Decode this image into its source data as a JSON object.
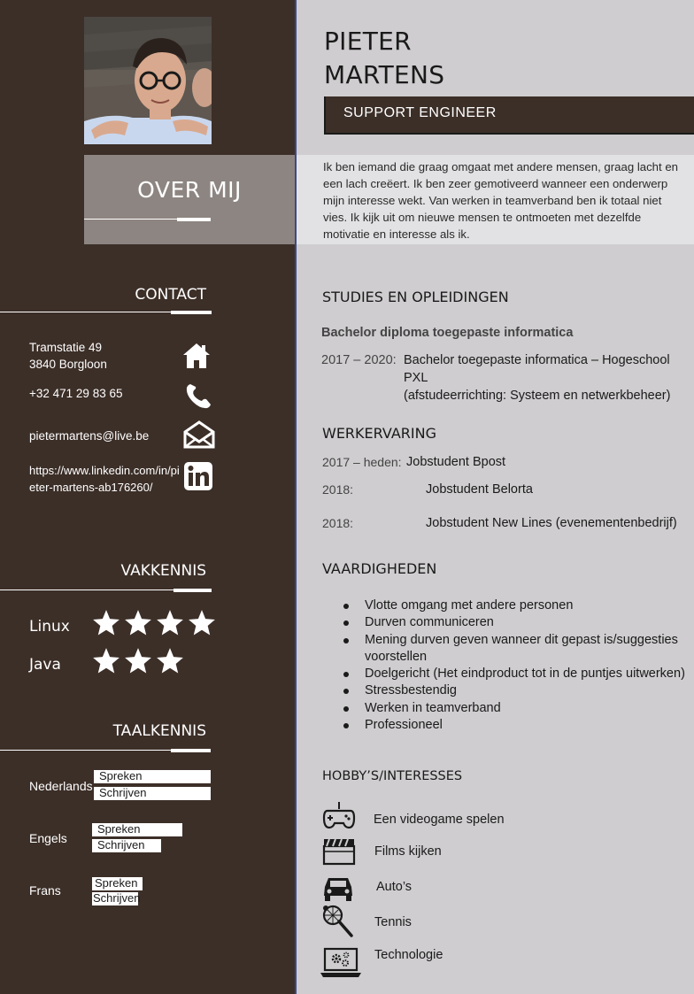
{
  "header": {
    "name_line1": "PIETER",
    "name_line2": "MARTENS",
    "role": "SUPPORT ENGINEER"
  },
  "about": {
    "title": "OVER MIJ",
    "text": "Ik ben iemand die graag omgaat met andere mensen,  graag lacht en een lach creëert.  Ik ben zeer gemotiveerd wanneer een onderwerp mijn interesse wekt. Van werken in teamverband ben ik totaal niet vies. Ik kijk uit om nieuwe mensen te ontmoeten met dezelfde motivatie en interesse als ik."
  },
  "contact": {
    "title": "CONTACT",
    "address_line1": "Tramstatie 49",
    "address_line2": "3840 Borgloon",
    "phone": "+32 471 29 83 65",
    "email": "pietermartens@live.be",
    "linkedin_line1": "https://www.linkedin.com/in/pi",
    "linkedin_line2": "eter-martens-ab176260/"
  },
  "vakkennis": {
    "title": "VAKKENNIS",
    "items": [
      {
        "label": "Linux",
        "stars": 4
      },
      {
        "label": "Java",
        "stars": 3
      }
    ]
  },
  "taalkennis": {
    "title": "TAALKENNIS",
    "languages": [
      {
        "label": "Nederlands",
        "spreken": "Spreken",
        "schrijven": "Schrijven",
        "spreken_level": 1.0,
        "schrijven_level": 1.0
      },
      {
        "label": "Engels",
        "spreken": "Spreken",
        "schrijven": "Schrijven",
        "spreken_level": 0.78,
        "schrijven_level": 0.58
      },
      {
        "label": "Frans",
        "spreken": "Spreken",
        "schrijven": "Schrijven",
        "spreken_level": 0.42,
        "schrijven_level": 0.38
      }
    ]
  },
  "studies": {
    "title": "STUDIES EN OPLEIDINGEN",
    "degree": "Bachelor diploma toegepaste informatica",
    "period": "2017 – 2020:",
    "line1": "Bachelor toegepaste informatica – Hogeschool PXL",
    "line2": "(afstudeerrichting: Systeem en netwerkbeheer)"
  },
  "werk": {
    "title": "WERKERVARING",
    "items": [
      {
        "period": "2017 – heden:",
        "job": "Jobstudent Bpost"
      },
      {
        "period": "2018:",
        "job": "Jobstudent Belorta"
      },
      {
        "period": "2018:",
        "job": "Jobstudent New Lines (evenementenbedrijf)"
      }
    ]
  },
  "vaardigheden": {
    "title": "VAARDIGHEDEN",
    "items": [
      "Vlotte omgang met andere personen",
      "Durven communiceren",
      "Mening durven geven wanneer dit gepast is/suggesties voorstellen",
      "Doelgericht (Het eindproduct tot in de puntjes uitwerken)",
      "Stressbestendig",
      "Werken in teamverband",
      "Professioneel"
    ]
  },
  "hobbys": {
    "title": "HOBBY’S/INTERESSES",
    "items": [
      {
        "label": "Een videogame spelen",
        "icon": "gamepad-icon"
      },
      {
        "label": "Films kijken",
        "icon": "clapperboard-icon"
      },
      {
        "label": "Auto’s",
        "icon": "car-icon"
      },
      {
        "label": "Tennis",
        "icon": "tennis-racket-icon"
      },
      {
        "label": "Technologie",
        "icon": "laptop-gear-icon"
      }
    ]
  },
  "colors": {
    "sidebar": "#3c2f28",
    "main_bg": "#cfcdcf",
    "about_left": "#8d8581",
    "about_right": "#e2e2e4",
    "accent_line": "#3a4a8a"
  }
}
